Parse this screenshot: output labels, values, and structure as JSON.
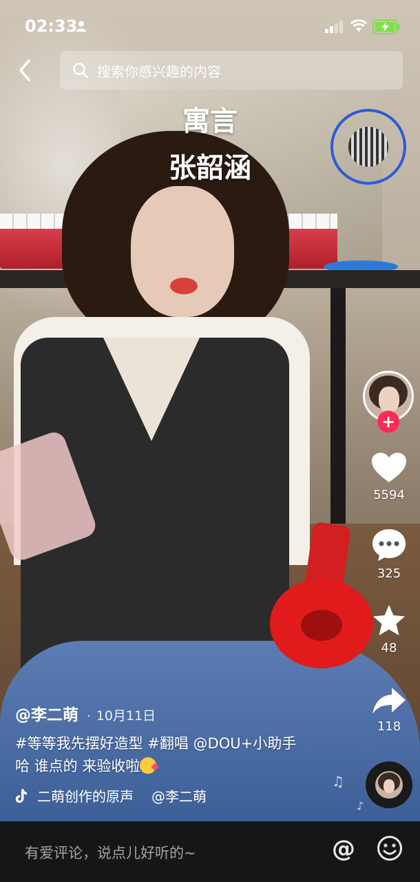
{
  "status_bar": {
    "time": "02:33"
  },
  "search": {
    "placeholder": "搜索你感兴趣的内容"
  },
  "lyrics": [
    "寓言",
    "张韶涵"
  ],
  "actions": {
    "likes": "5594",
    "comments": "325",
    "favorites": "48",
    "shares": "118",
    "follow_label": "+"
  },
  "post": {
    "author": "@李二萌",
    "separator": "·",
    "date": "10月11日",
    "caption": "#等等我先摆好造型 #翻唱 @DOU+小助手 哈 谁点的 来验收啦",
    "music_title": "二萌创作的原声",
    "music_author": "@李二萌"
  },
  "comment_bar": {
    "placeholder": "有爱评论，说点儿好听的~",
    "at_symbol": "@"
  },
  "colors": {
    "accent": "#fe2c55",
    "bar_bg": "#161616"
  },
  "icons": [
    "back-arrow-icon",
    "search-icon",
    "heart-icon",
    "comment-icon",
    "star-icon",
    "share-icon",
    "music-note-icon",
    "at-icon",
    "smile-icon"
  ]
}
